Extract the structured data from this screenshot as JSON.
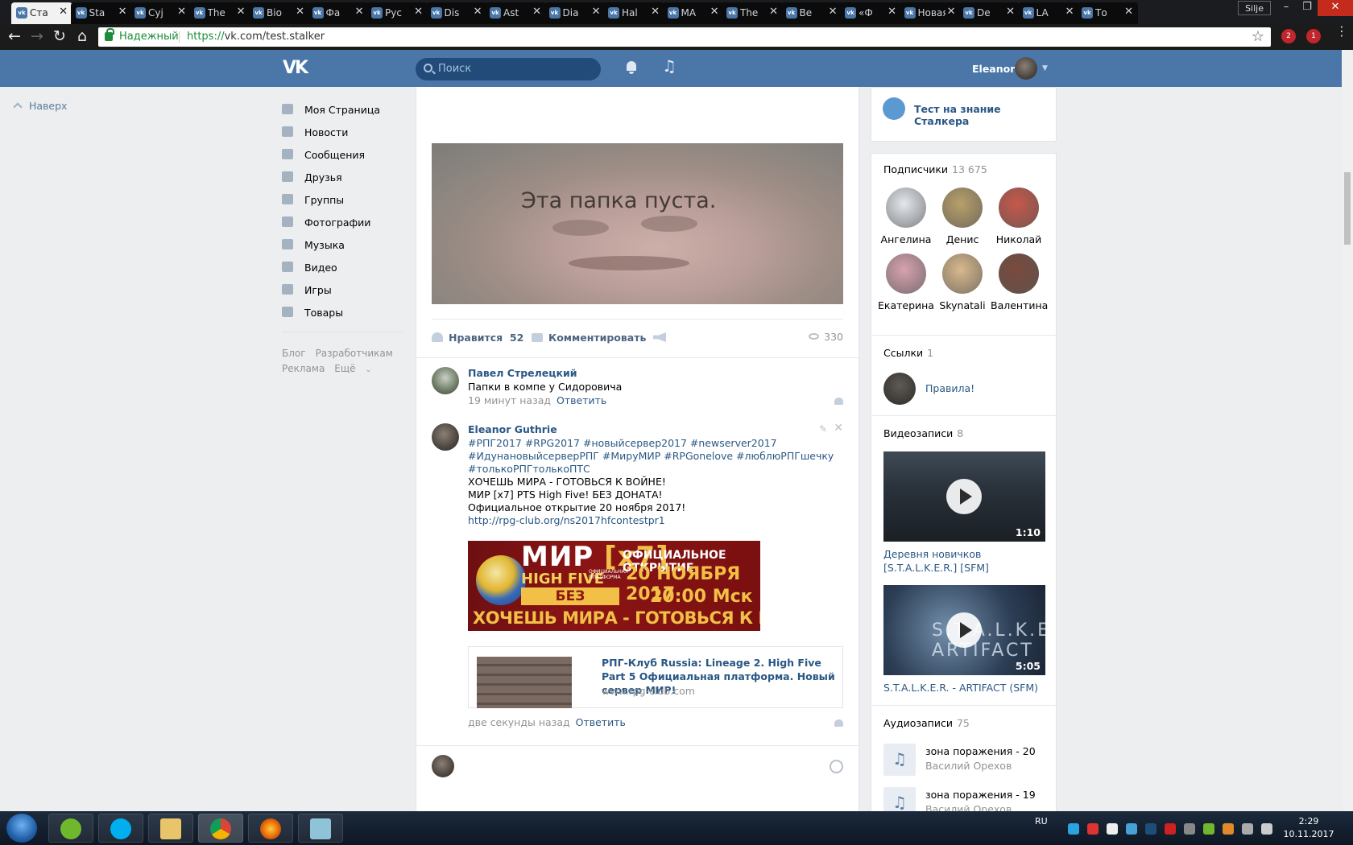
{
  "browser": {
    "tabs": [
      {
        "title": "Ста",
        "active": true
      },
      {
        "title": "Sta"
      },
      {
        "title": "Суј"
      },
      {
        "title": "The"
      },
      {
        "title": "Bio"
      },
      {
        "title": "Фа"
      },
      {
        "title": "Рус"
      },
      {
        "title": "Dis"
      },
      {
        "title": "Ast"
      },
      {
        "title": "Dia"
      },
      {
        "title": "Hal"
      },
      {
        "title": "МА"
      },
      {
        "title": "The"
      },
      {
        "title": "Be"
      },
      {
        "title": "«Ф"
      },
      {
        "title": "Новая"
      },
      {
        "title": "De"
      },
      {
        "title": "LA"
      },
      {
        "title": "То"
      }
    ],
    "window_user": "Silje",
    "secure_label": "Надежный",
    "url_proto": "https://",
    "url_rest": "vk.com/test.stalker",
    "ext_badges": [
      "2",
      "1"
    ]
  },
  "header": {
    "search_placeholder": "Поиск",
    "user_name": "Eleanor"
  },
  "upbtn": "Наверх",
  "nav": [
    {
      "label": "Моя Страница",
      "icon": "home-icon"
    },
    {
      "label": "Новости",
      "icon": "news-icon"
    },
    {
      "label": "Сообщения",
      "icon": "messages-icon"
    },
    {
      "label": "Друзья",
      "icon": "friends-icon"
    },
    {
      "label": "Группы",
      "icon": "groups-icon"
    },
    {
      "label": "Фотографии",
      "icon": "camera-icon"
    },
    {
      "label": "Музыка",
      "icon": "music-icon"
    },
    {
      "label": "Видео",
      "icon": "video-icon"
    },
    {
      "label": "Игры",
      "icon": "games-icon"
    },
    {
      "label": "Товары",
      "icon": "goods-icon"
    }
  ],
  "footer": {
    "blog": "Блог",
    "devs": "Разработчикам",
    "ads": "Реклама",
    "more": "Ещё"
  },
  "post": {
    "photo_caption": "Эта папка пуста.",
    "like_label": "Нравится",
    "like_count": "52",
    "comment_label": "Комментировать",
    "views": "330"
  },
  "comments": [
    {
      "author": "Павел Стрелецкий",
      "text": "Папки в компе у Сидоровича",
      "time": "19 минут назад",
      "reply": "Ответить"
    },
    {
      "author": "Eleanor Guthrie",
      "hashtags1": "#РПГ2017 #RPG2017 #новыйсервер2017 #newserver2017",
      "hashtags2": "#ИдунановыйсерверРПГ #МируМИР #RPGonelove #люблюРПГшечку",
      "hashtags3": "#толькоРПГтолькоПТС",
      "line1": "ХОЧЕШЬ МИРА - ГОТОВЬСЯ К ВОЙНЕ!",
      "line2": "МИР [x7] PTS High Five! БЕЗ ДОНАТА!",
      "line3": "Официальное открытие 20 ноября 2017!",
      "link": "http://rpg-club.org/ns2017hfcontestpr1",
      "banner": {
        "title_a": "МИР",
        "title_b": "[x7]",
        "sub": "HIGH FIVE",
        "platform": "ОФИЦИАЛЬНАЯ ПЛАТФОРМА",
        "nodonate": "БЕЗ ДОНАТА",
        "opening": "ОФИЦИАЛЬНОЕ ОТКРЫТИЕ",
        "date": "20 НОЯБРЯ 2017",
        "time": "20:00 Мск",
        "slogan": "ХОЧЕШЬ МИРА - ГОТОВЬСЯ К ВОЙНЕ"
      },
      "card": {
        "title": "РПГ-Клуб Russia: Lineage 2. High Five Part 5 Официальная платформа. Новый сервер МИР!",
        "domain": "www.rpg-club.com"
      },
      "time": "две секунды назад",
      "reply": "Ответить"
    }
  ],
  "right": {
    "app_title": "Тест на знание Сталкера",
    "subs_title": "Подписчики",
    "subs_count": "13 675",
    "subs": [
      {
        "name": "Ангелина",
        "color": "#e4e9ef"
      },
      {
        "name": "Денис",
        "color": "#b8a06a"
      },
      {
        "name": "Николай",
        "color": "#c7584a"
      },
      {
        "name": "Екатерина",
        "color": "#d7a3b0"
      },
      {
        "name": "Skynatali",
        "color": "#d9b98d"
      },
      {
        "name": "Валентина",
        "color": "#7a4a3c"
      }
    ],
    "links_title": "Ссылки",
    "links_count": "1",
    "link_label": "Правила!",
    "videos_title": "Видеозаписи",
    "videos_count": "8",
    "videos": [
      {
        "title": "Деревня новичков [S.T.A.L.K.E.R.] [SFM]",
        "duration": "1:10"
      },
      {
        "title": "S.T.A.L.K.E.R. - ARTIFACT (SFM)",
        "duration": "5:05",
        "overlay": "S.T.A.L.K.E.R ARTIFACT"
      }
    ],
    "audio_title": "Аудиозаписи",
    "audio_count": "75",
    "audio": [
      {
        "title": "зона поражения - 20",
        "artist": "Василий Орехов"
      },
      {
        "title": "зона поражения - 19",
        "artist": "Василий Орехов"
      }
    ]
  },
  "taskbar": {
    "lang": "RU",
    "time": "2:29",
    "date": "10.11.2017"
  }
}
